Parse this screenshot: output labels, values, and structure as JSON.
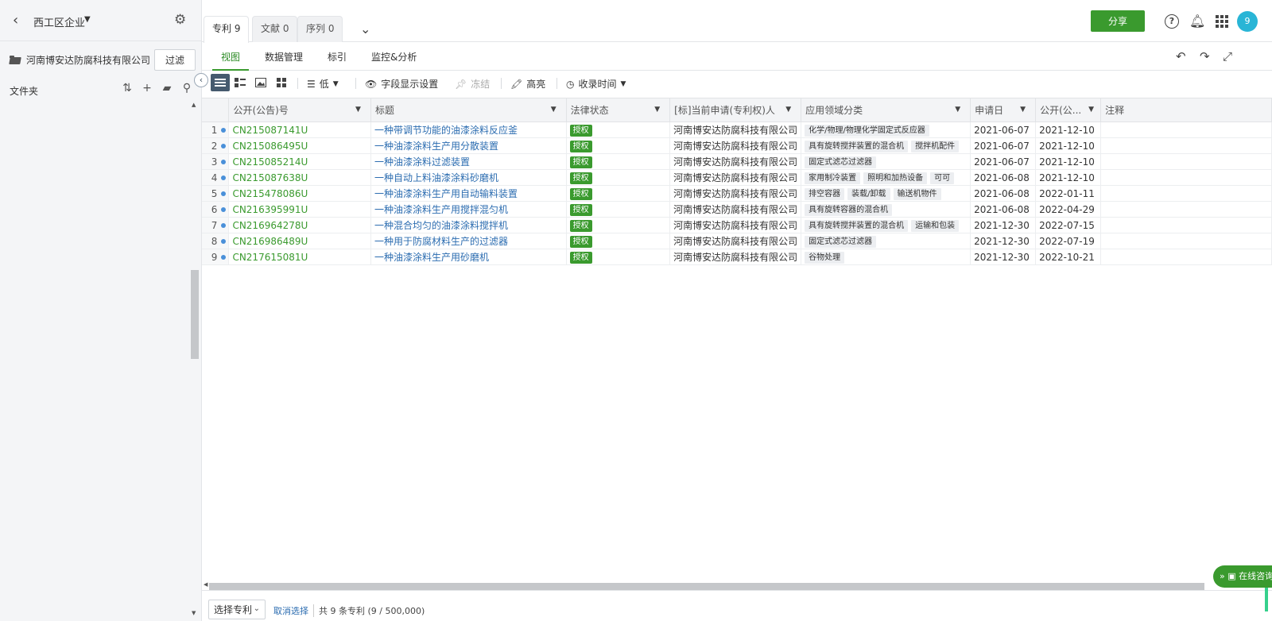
{
  "sidebar": {
    "title": "西工区企业",
    "company": "河南博安达防腐科技有限公司",
    "filter_label": "过滤",
    "folder_label": "文件夹"
  },
  "tabs": [
    {
      "label": "专利 9"
    },
    {
      "label": "文献 0"
    },
    {
      "label": "序列 0"
    }
  ],
  "header": {
    "share_label": "分享",
    "avatar_text": "9",
    "accent_color": "#3a9a2e"
  },
  "subnav": [
    {
      "label": "视图"
    },
    {
      "label": "数据管理"
    },
    {
      "label": "标引"
    },
    {
      "label": "监控&分析"
    }
  ],
  "toolbar": {
    "density_label": "低",
    "fields_label": "字段显示设置",
    "freeze_label": "冻结",
    "highlight_label": "高亮",
    "sort_label": "收录时间"
  },
  "table": {
    "columns": [
      "公开(公告)号",
      "标题",
      "法律状态",
      "[标]当前申请(专利权)人",
      "应用领域分类",
      "申请日",
      "公开(公...",
      "注释"
    ],
    "rows": [
      {
        "num": "1",
        "pn": "CN215087141U",
        "title": "一种带调节功能的油漆涂料反应釜",
        "status": "授权",
        "applicant": "河南博安达防腐科技有限公司",
        "tags": [
          "化学/物理/物理化学固定式反应器"
        ],
        "app_date": "2021-06-07",
        "pub_date": "2021-12-10"
      },
      {
        "num": "2",
        "pn": "CN215086495U",
        "title": "一种油漆涂料生产用分散装置",
        "status": "授权",
        "applicant": "河南博安达防腐科技有限公司",
        "tags": [
          "具有旋转搅拌装置的混合机",
          "搅拌机配件"
        ],
        "app_date": "2021-06-07",
        "pub_date": "2021-12-10"
      },
      {
        "num": "3",
        "pn": "CN215085214U",
        "title": "一种油漆涂料过滤装置",
        "status": "授权",
        "applicant": "河南博安达防腐科技有限公司",
        "tags": [
          "固定式滤芯过滤器"
        ],
        "app_date": "2021-06-07",
        "pub_date": "2021-12-10"
      },
      {
        "num": "4",
        "pn": "CN215087638U",
        "title": "一种自动上料油漆涂料砂磨机",
        "status": "授权",
        "applicant": "河南博安达防腐科技有限公司",
        "tags": [
          "家用制冷装置",
          "照明和加热设备",
          "可可"
        ],
        "app_date": "2021-06-08",
        "pub_date": "2021-12-10"
      },
      {
        "num": "5",
        "pn": "CN215478086U",
        "title": "一种油漆涂料生产用自动输料装置",
        "status": "授权",
        "applicant": "河南博安达防腐科技有限公司",
        "tags": [
          "排空容器",
          "装载/卸载",
          "输送机物件"
        ],
        "app_date": "2021-06-08",
        "pub_date": "2022-01-11"
      },
      {
        "num": "6",
        "pn": "CN216395991U",
        "title": "一种油漆涂料生产用搅拌混匀机",
        "status": "授权",
        "applicant": "河南博安达防腐科技有限公司",
        "tags": [
          "具有旋转容器的混合机"
        ],
        "app_date": "2021-06-08",
        "pub_date": "2022-04-29"
      },
      {
        "num": "7",
        "pn": "CN216964278U",
        "title": "一种混合均匀的油漆涂料搅拌机",
        "status": "授权",
        "applicant": "河南博安达防腐科技有限公司",
        "tags": [
          "具有旋转搅拌装置的混合机",
          "运输和包装"
        ],
        "app_date": "2021-12-30",
        "pub_date": "2022-07-15"
      },
      {
        "num": "8",
        "pn": "CN216986489U",
        "title": "一种用于防腐材料生产的过滤器",
        "status": "授权",
        "applicant": "河南博安达防腐科技有限公司",
        "tags": [
          "固定式滤芯过滤器"
        ],
        "app_date": "2021-12-30",
        "pub_date": "2022-07-19"
      },
      {
        "num": "9",
        "pn": "CN217615081U",
        "title": "一种油漆涂料生产用砂磨机",
        "status": "授权",
        "applicant": "河南博安达防腐科技有限公司",
        "tags": [
          "谷物处理"
        ],
        "app_date": "2021-12-30",
        "pub_date": "2022-10-21"
      }
    ]
  },
  "footer": {
    "select_label": "选择专利",
    "cancel_label": "取消选择",
    "count_text": "共 9 条专利 (9 / 500,000)"
  },
  "chat_label": "在线咨询"
}
